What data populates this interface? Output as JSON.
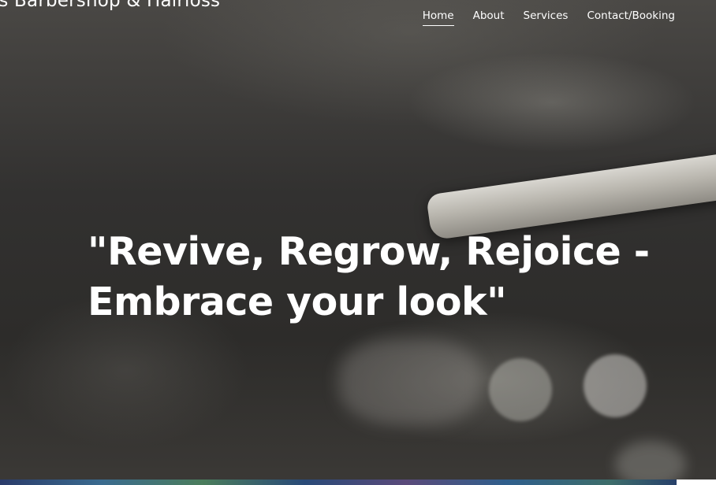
{
  "header": {
    "site_title": "es Barbershop & Hairloss"
  },
  "nav": {
    "items": [
      {
        "label": "Home",
        "active": true
      },
      {
        "label": "About",
        "active": false
      },
      {
        "label": "Services",
        "active": false
      },
      {
        "label": "Contact/Booking",
        "active": false
      }
    ]
  },
  "hero": {
    "headline": "\"Revive, Regrow, Rejoice - Embrace your look\"",
    "background": "black-and-white straight razor photo"
  },
  "colors": {
    "text": "#ffffff",
    "background": "#2b2a28"
  }
}
